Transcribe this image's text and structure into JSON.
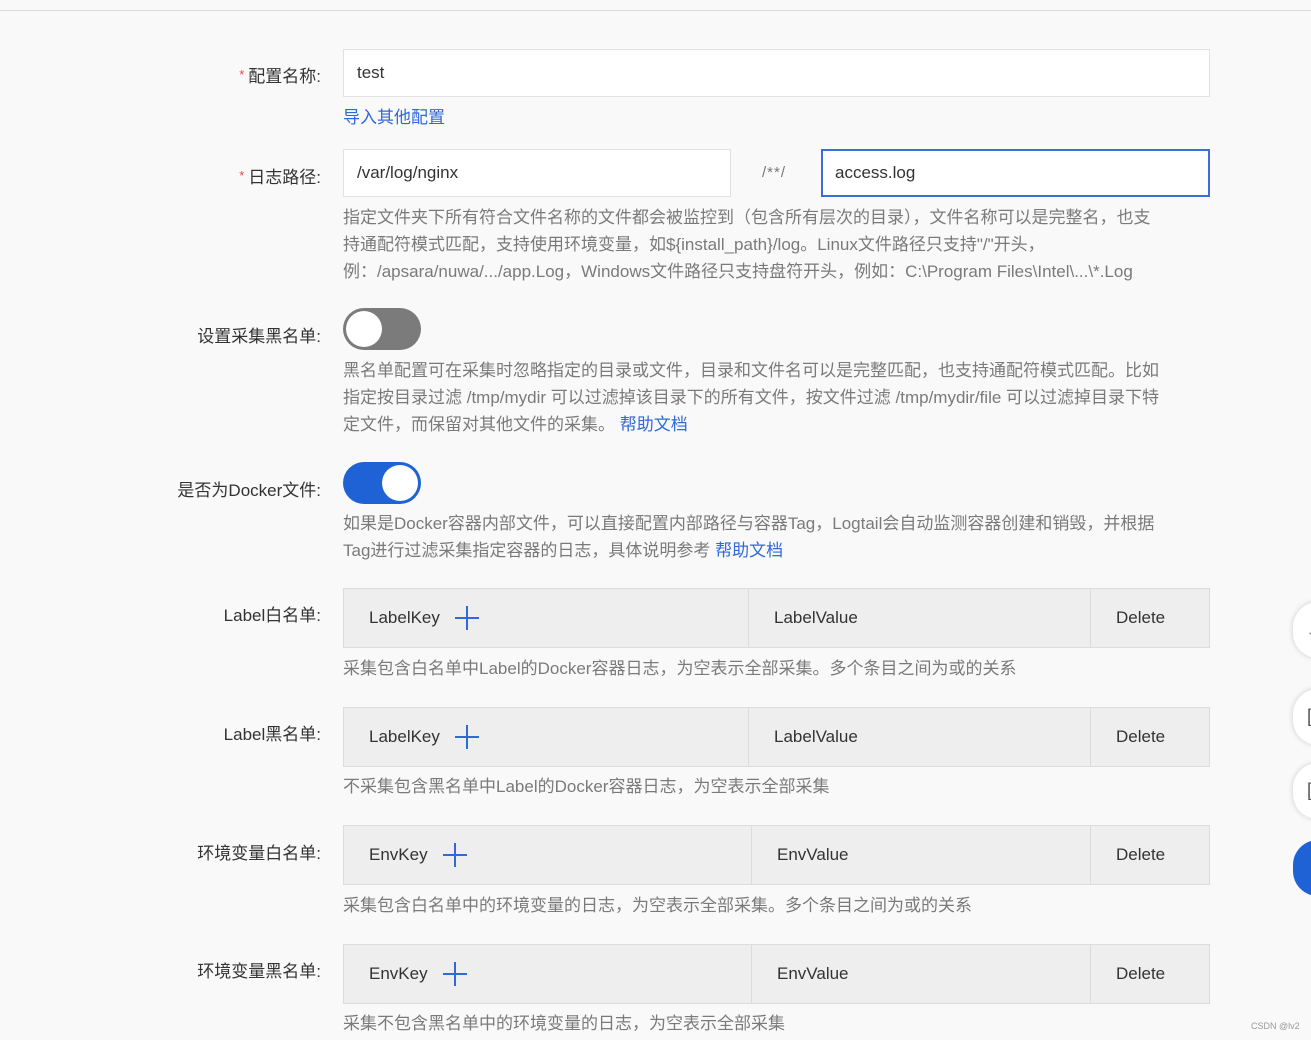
{
  "config_name": {
    "label": "配置名称:",
    "value": "test",
    "import_link": "导入其他配置"
  },
  "log_path": {
    "label": "日志路径:",
    "dir_value": "/var/log/nginx",
    "separator": "/**/",
    "file_value": "access.log",
    "help_line1": "指定文件夹下所有符合文件名称的文件都会被监控到（包含所有层次的目录），文件名称可以是完整名，也支",
    "help_line2": "持通配符模式匹配，支持使用环境变量，如${install_path}/log。Linux文件路径只支持\"/\"开头，",
    "help_line3": "例：/apsara/nuwa/.../app.Log，Windows文件路径只支持盘符开头，例如：C:\\Program Files\\Intel\\...\\*.Log"
  },
  "blacklist": {
    "label": "设置采集黑名单:",
    "state": "off",
    "help_line1": "黑名单配置可在采集时忽略指定的目录或文件，目录和文件名可以是完整匹配，也支持通配符模式匹配。比如",
    "help_line2": "指定按目录过滤 /tmp/mydir 可以过滤掉该目录下的所有文件，按文件过滤 /tmp/mydir/file 可以过滤掉目录下特",
    "help_line3": "定文件，而保留对其他文件的采集。",
    "help_link": "帮助文档"
  },
  "docker": {
    "label": "是否为Docker文件:",
    "state": "on",
    "help_line1": "如果是Docker容器内部文件，可以直接配置内部路径与容器Tag，Logtail会自动监测容器创建和销毁，并根据",
    "help_line2": "Tag进行过滤采集指定容器的日志，具体说明参考",
    "help_link": "帮助文档"
  },
  "label_whitelist": {
    "label": "Label白名单:",
    "col_key": "LabelKey",
    "col_value": "LabelValue",
    "col_delete": "Delete",
    "help": "采集包含白名单中Label的Docker容器日志，为空表示全部采集。多个条目之间为或的关系"
  },
  "label_blacklist": {
    "label": "Label黑名单:",
    "col_key": "LabelKey",
    "col_value": "LabelValue",
    "col_delete": "Delete",
    "help": "不采集包含黑名单中Label的Docker容器日志，为空表示全部采集"
  },
  "env_whitelist": {
    "label": "环境变量白名单:",
    "col_key": "EnvKey",
    "col_value": "EnvValue",
    "col_delete": "Delete",
    "help": "采集包含白名单中的环境变量的日志，为空表示全部采集。多个条目之间为或的关系"
  },
  "env_blacklist": {
    "label": "环境变量黑名单:",
    "col_key": "EnvKey",
    "col_value": "EnvValue",
    "col_delete": "Delete",
    "help": "采集不包含黑名单中的环境变量的日志，为空表示全部采集"
  },
  "floaters": [
    "↓",
    "[",
    "["
  ],
  "watermark": "CSDN @lv2",
  "colors": {
    "accent": "#1e62d6",
    "link": "#2f6ad8",
    "required": "#e64646"
  }
}
